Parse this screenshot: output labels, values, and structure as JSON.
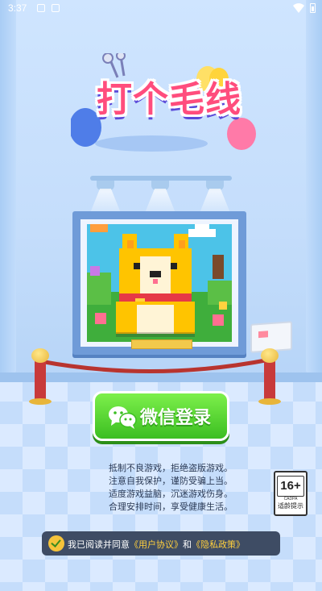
{
  "status_bar": {
    "time": "3:37"
  },
  "logo": {
    "title": "打个毛线"
  },
  "login": {
    "wechat_label": "微信登录"
  },
  "notice": {
    "lines": [
      "抵制不良游戏，拒绝盗版游戏。",
      "注意自我保护，谨防受骗上当。",
      "适度游戏益脑，沉迷游戏伤身。",
      "合理安排时间，享受健康生活。"
    ]
  },
  "age_rating": {
    "age": "16+",
    "org": "CADPA",
    "tip": "适龄提示"
  },
  "agreement": {
    "prefix": "我已阅读并同意",
    "user_agreement": "《用户协议》",
    "and": "和",
    "privacy_policy": "《隐私政策》"
  },
  "colors": {
    "accent": "#3bbe21",
    "logo": "#ff4d7d",
    "agree_bar": "#3e4c64",
    "link": "#ffcf3d"
  }
}
